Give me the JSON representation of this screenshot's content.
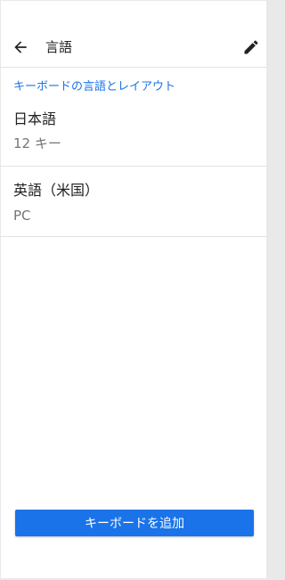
{
  "appbar": {
    "title": "言語",
    "back_icon": "arrow-back-icon",
    "edit_icon": "pencil-icon"
  },
  "section": {
    "header": "キーボードの言語とレイアウト"
  },
  "languages": [
    {
      "name": "日本語",
      "layout": "12 キー"
    },
    {
      "name": "英語（米国）",
      "layout": "PC"
    }
  ],
  "actions": {
    "add_keyboard_label": "キーボードを追加"
  },
  "colors": {
    "accent": "#1a73e8",
    "primary_text": "#202124",
    "secondary_text": "#757575",
    "divider": "#e3e3e3",
    "background": "#ffffff"
  }
}
